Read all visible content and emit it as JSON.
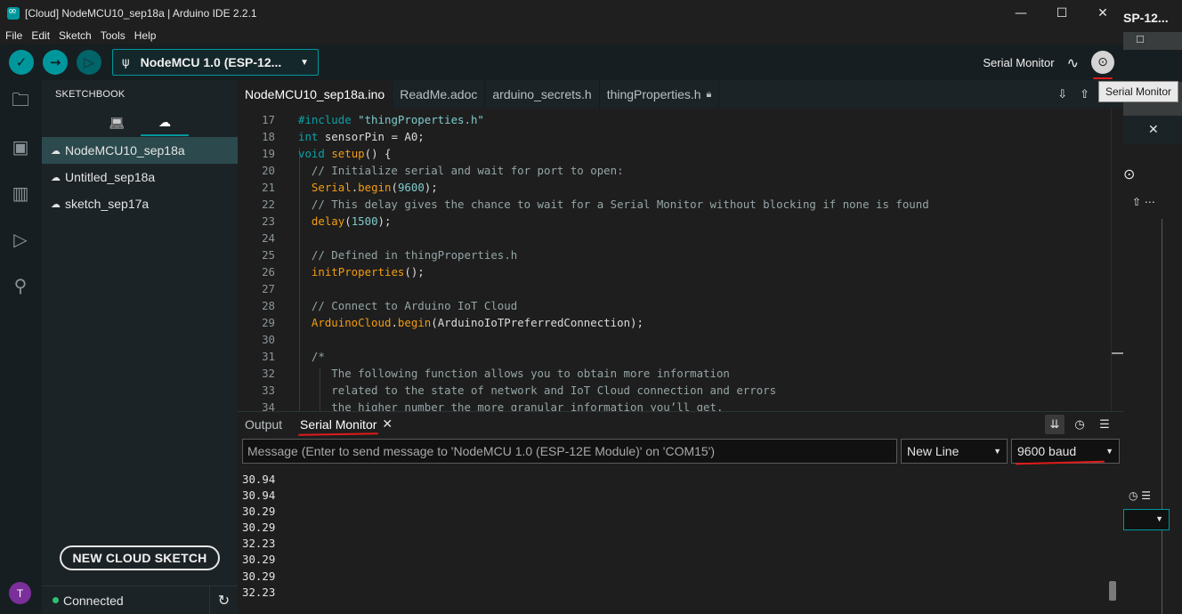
{
  "window": {
    "title": "[Cloud] NodeMCU10_sep18a | Arduino IDE 2.2.1",
    "minimize": "—",
    "maximize": "☐",
    "close": "✕"
  },
  "menu": [
    "File",
    "Edit",
    "Sketch",
    "Tools",
    "Help"
  ],
  "toolbar": {
    "verify_icon": "✓",
    "upload_icon": "→",
    "debug_icon": "▷",
    "board_icon": "usb-icon",
    "board_label": "NodeMCU 1.0 (ESP-12...",
    "serial_monitor_label": "Serial Monitor",
    "plotter_icon": "∿",
    "serial_monitor_icon": "⊙"
  },
  "tooltip": "Serial Monitor",
  "activity": {
    "avatar_initial": "T"
  },
  "sidebar": {
    "title": "SKETCHBOOK",
    "tab_local_icon": "laptop-icon",
    "tab_cloud_icon": "cloud-icon",
    "items": [
      {
        "label": "NodeMCU10_sep18a",
        "active": true
      },
      {
        "label": "Untitled_sep18a",
        "active": false
      },
      {
        "label": "sketch_sep17a",
        "active": false
      }
    ],
    "new_sketch_button": "NEW CLOUD SKETCH",
    "status": "Connected"
  },
  "tabs": [
    {
      "label": "NodeMCU10_sep18a.ino",
      "active": true
    },
    {
      "label": "ReadMe.adoc",
      "active": false
    },
    {
      "label": "arduino_secrets.h",
      "active": false
    },
    {
      "label": "thingProperties.h",
      "active": false,
      "locked": true
    }
  ],
  "code": {
    "line_numbers": [
      "17",
      "18",
      "19",
      "20",
      "21",
      "22",
      "23",
      "24",
      "25",
      "26",
      "27",
      "28",
      "29",
      "30",
      "31",
      "32",
      "33",
      "34"
    ],
    "lines": [
      [
        {
          "t": "#include ",
          "c": "kw"
        },
        {
          "t": "\"thingProperties.h\"",
          "c": "str"
        }
      ],
      [
        {
          "t": "int",
          "c": "kw"
        },
        {
          "t": " sensorPin = A0;",
          "c": ""
        }
      ],
      [
        {
          "t": "void",
          "c": "kw"
        },
        {
          "t": " ",
          "c": ""
        },
        {
          "t": "setup",
          "c": "fn"
        },
        {
          "t": "() {",
          "c": ""
        }
      ],
      [
        {
          "t": "  // Initialize serial and wait for port to open:",
          "c": "cm"
        }
      ],
      [
        {
          "t": "  ",
          "c": ""
        },
        {
          "t": "Serial",
          "c": "fn"
        },
        {
          "t": ".",
          "c": ""
        },
        {
          "t": "begin",
          "c": "fn"
        },
        {
          "t": "(",
          "c": ""
        },
        {
          "t": "9600",
          "c": "num"
        },
        {
          "t": ");",
          "c": ""
        }
      ],
      [
        {
          "t": "  // This delay gives the chance to wait for a Serial Monitor without blocking if none is found",
          "c": "cm"
        }
      ],
      [
        {
          "t": "  ",
          "c": ""
        },
        {
          "t": "delay",
          "c": "fn"
        },
        {
          "t": "(",
          "c": ""
        },
        {
          "t": "1500",
          "c": "num"
        },
        {
          "t": ");",
          "c": ""
        }
      ],
      [],
      [
        {
          "t": "  // Defined in thingProperties.h",
          "c": "cm"
        }
      ],
      [
        {
          "t": "  ",
          "c": ""
        },
        {
          "t": "initProperties",
          "c": "fn"
        },
        {
          "t": "();",
          "c": ""
        }
      ],
      [],
      [
        {
          "t": "  // Connect to Arduino IoT Cloud",
          "c": "cm"
        }
      ],
      [
        {
          "t": "  ",
          "c": ""
        },
        {
          "t": "ArduinoCloud",
          "c": "fn"
        },
        {
          "t": ".",
          "c": ""
        },
        {
          "t": "begin",
          "c": "fn"
        },
        {
          "t": "(ArduinoIoTPreferredConnection);",
          "c": ""
        }
      ],
      [],
      [
        {
          "t": "  /*",
          "c": "cm"
        }
      ],
      [
        {
          "t": "     The following function allows you to obtain more information",
          "c": "cm"
        }
      ],
      [
        {
          "t": "     related to the state of network and IoT Cloud connection and errors",
          "c": "cm"
        }
      ],
      [
        {
          "t": "     the higher number the more granular information you’ll get.",
          "c": "cm"
        }
      ]
    ]
  },
  "panel": {
    "tab_output": "Output",
    "tab_serial": "Serial Monitor",
    "tab_close": "✕",
    "message_placeholder": "Message (Enter to send message to 'NodeMCU 1.0 (ESP-12E Module)' on 'COM15')",
    "line_ending": "New Line",
    "baud": "9600 baud",
    "output": [
      "30.94",
      "30.94",
      "30.29",
      "30.29",
      "32.23",
      "30.29",
      "30.29",
      "32.23"
    ]
  },
  "behind_window": {
    "title": "SP-12...",
    "close": "✕"
  }
}
